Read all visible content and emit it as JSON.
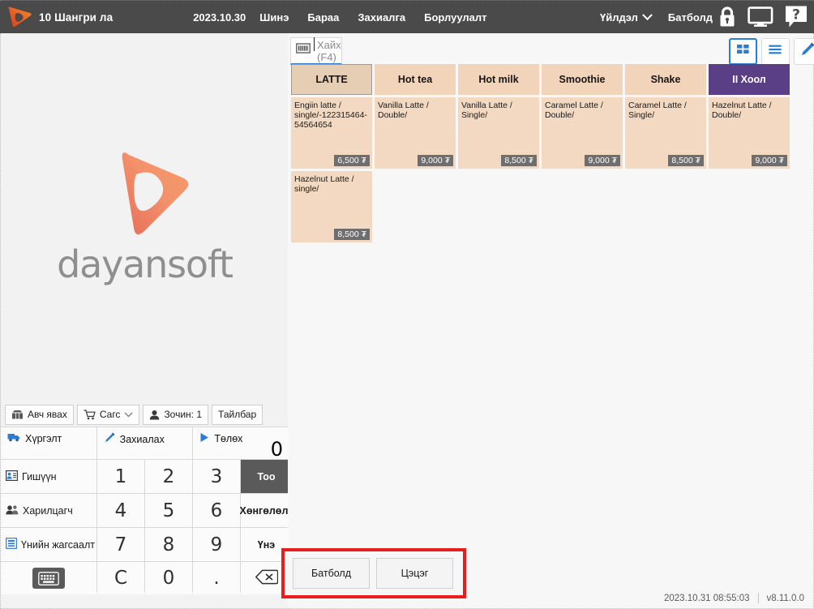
{
  "titlebar": {
    "logo_icon": "dayansoft-logo-icon",
    "shop_title": "10 Шангри ла",
    "date": "2023.10.30",
    "menu": [
      {
        "label": "Шинэ"
      },
      {
        "label": "Бараа"
      },
      {
        "label": "Захиалга"
      },
      {
        "label": "Борлуулалт"
      }
    ],
    "action_label": "Үйлдэл",
    "user_name": "Батболд",
    "lock_icon": "lock-icon",
    "screen_icon": "monitor-icon",
    "help_icon": "help-icon"
  },
  "left": {
    "logo_word": "dayansoft",
    "small_buttons": [
      {
        "label": "Авч явах",
        "icon": "takeaway-bag-icon",
        "has_chevron": false
      },
      {
        "label": "Сагс",
        "icon": "cart-icon",
        "has_chevron": true
      },
      {
        "label": "Зочин: 1",
        "icon": "guest-icon",
        "has_chevron": false
      },
      {
        "label": "Тайлбар",
        "icon": "",
        "has_chevron": false
      }
    ],
    "actions": [
      {
        "label": "Хүргэлт",
        "icon": "delivery-truck-icon"
      },
      {
        "label": "Захиалах",
        "icon": "pencil-icon"
      },
      {
        "label": "Төлөх",
        "icon": "play-icon"
      }
    ],
    "total": "0",
    "side_buttons": [
      {
        "label": "Гишүүн",
        "icon": "member-card-icon"
      },
      {
        "label": "Харилцагч",
        "icon": "customers-icon"
      },
      {
        "label": "Үнийн жагсаалт",
        "icon": "price-list-icon"
      },
      {
        "label": "",
        "icon": "keyboard-icon"
      }
    ],
    "keys": [
      "1",
      "2",
      "3",
      "4",
      "5",
      "6",
      "7",
      "8",
      "9",
      "C",
      "0",
      "."
    ],
    "func_keys": [
      {
        "label": "Тоо",
        "selected": true
      },
      {
        "label": "Хөнгөлөлт",
        "selected": false
      },
      {
        "label": "Үнэ",
        "selected": false
      },
      {
        "label": "",
        "selected": false,
        "icon": "backspace-icon"
      }
    ]
  },
  "search": {
    "placeholder": "Хайх (F4)",
    "scanner_icon": "barcode-scanner-icon"
  },
  "view_buttons": [
    {
      "name": "grid-view",
      "icon": "grid-icon",
      "active": true
    },
    {
      "name": "list-view",
      "icon": "list-icon",
      "active": false
    },
    {
      "name": "edit",
      "icon": "pencil-icon",
      "active": false
    },
    {
      "name": "add",
      "icon": "plus-icon",
      "active": false
    }
  ],
  "categories": [
    {
      "label": "LATTE",
      "selected": true,
      "style": "normal"
    },
    {
      "label": "Hot tea",
      "selected": false,
      "style": "normal"
    },
    {
      "label": "Hot milk",
      "selected": false,
      "style": "normal"
    },
    {
      "label": "Smoothie",
      "selected": false,
      "style": "normal"
    },
    {
      "label": "Shake",
      "selected": false,
      "style": "normal"
    },
    {
      "label": "II Хоол",
      "selected": false,
      "style": "alt"
    }
  ],
  "products": [
    {
      "name": "Engiin latte / single/-122315464-54564654",
      "price": "6,500 ₮"
    },
    {
      "name": "Vanilla Latte / Double/",
      "price": "9,000 ₮"
    },
    {
      "name": "Vanilla Latte / Single/",
      "price": "8,500 ₮"
    },
    {
      "name": "Caramel Latte / Double/",
      "price": "9,000 ₮"
    },
    {
      "name": "Caramel Latte / Single/",
      "price": "8,500 ₮"
    },
    {
      "name": "Hazelnut Latte / Double/",
      "price": "9,000 ₮"
    },
    {
      "name": "Hazelnut Latte / single/",
      "price": "8,500 ₮"
    }
  ],
  "confirm": {
    "buttons": [
      {
        "label": "Батболд"
      },
      {
        "label": "Цэцэг"
      }
    ],
    "highlight_color": "#e61e1e"
  },
  "statusbar": {
    "datetime": "2023.10.31 08:55:03",
    "version": "v8.11.0.0"
  }
}
